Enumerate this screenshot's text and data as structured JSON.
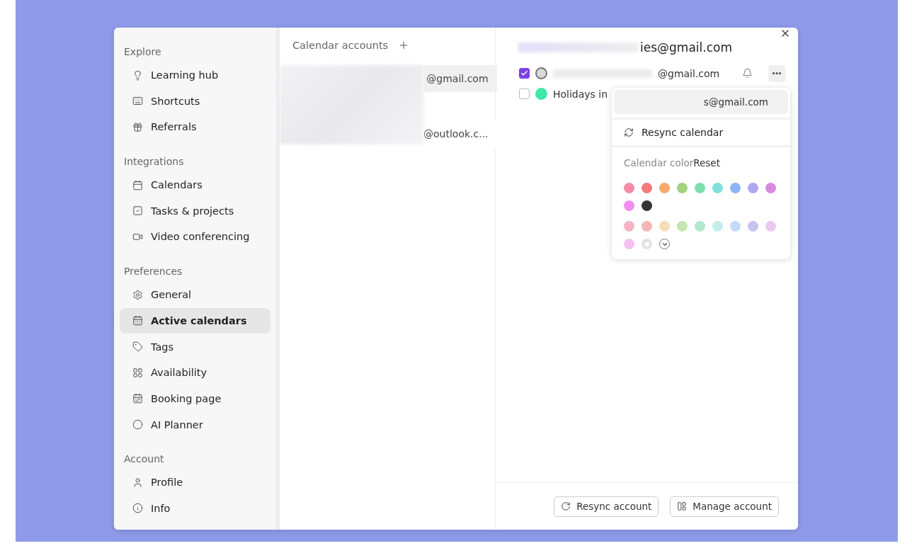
{
  "sidebar": {
    "sections": [
      {
        "title": "Explore",
        "items": [
          {
            "label": "Learning hub",
            "selected": false
          },
          {
            "label": "Shortcuts",
            "selected": false
          },
          {
            "label": "Referrals",
            "selected": false
          }
        ]
      },
      {
        "title": "Integrations",
        "items": [
          {
            "label": "Calendars",
            "selected": false
          },
          {
            "label": "Tasks & projects",
            "selected": false
          },
          {
            "label": "Video conferencing",
            "selected": false
          }
        ]
      },
      {
        "title": "Preferences",
        "items": [
          {
            "label": "General",
            "selected": false
          },
          {
            "label": "Active calendars",
            "selected": true
          },
          {
            "label": "Tags",
            "selected": false
          },
          {
            "label": "Availability",
            "selected": false
          },
          {
            "label": "Booking page",
            "selected": false
          },
          {
            "label": "AI Planner",
            "selected": false
          }
        ]
      },
      {
        "title": "Account",
        "items": [
          {
            "label": "Profile",
            "selected": false
          },
          {
            "label": "Info",
            "selected": false
          }
        ]
      }
    ]
  },
  "accounts": {
    "title": "Calendar accounts",
    "items": [
      {
        "label": "@gmail.com",
        "selected": true
      },
      {
        "label": "@outlook.c...",
        "selected": false
      }
    ]
  },
  "detail": {
    "title": "ies@gmail.com",
    "calendars": [
      {
        "label": "@gmail.com",
        "checked": true,
        "color": "#d9d9d9"
      },
      {
        "label": "Holidays in",
        "checked": false,
        "color": "#3ee8a8"
      }
    ],
    "menu": {
      "account": "s@gmail.com",
      "resync": "Resync calendar",
      "color_label": "Calendar color",
      "reset": "Reset",
      "swatches": [
        {
          "color": "#f58aa8",
          "selected": false
        },
        {
          "color": "#f57a7a",
          "selected": false
        },
        {
          "color": "#f8a96a",
          "selected": false
        },
        {
          "color": "#a3d17f",
          "selected": false
        },
        {
          "color": "#7ddfb0",
          "selected": false
        },
        {
          "color": "#7fe0de",
          "selected": false
        },
        {
          "color": "#8ab6f5",
          "selected": false
        },
        {
          "color": "#b3a6f0",
          "selected": false
        },
        {
          "color": "#d68ae0",
          "selected": false
        },
        {
          "color": "#f28ef0",
          "selected": false
        },
        {
          "color": "#333333",
          "selected": false
        }
      ],
      "light_swatches": [
        {
          "color": "#f5b3c4",
          "selected": false
        },
        {
          "color": "#f5b5b5",
          "selected": false
        },
        {
          "color": "#f7dcb8",
          "selected": false
        },
        {
          "color": "#c6e5b0",
          "selected": false
        },
        {
          "color": "#b3e8cf",
          "selected": false
        },
        {
          "color": "#c4ede9",
          "selected": false
        },
        {
          "color": "#c6daf7",
          "selected": false
        },
        {
          "color": "#c9c3f0",
          "selected": false
        },
        {
          "color": "#eec6f2",
          "selected": false
        },
        {
          "color": "#f3c0f0",
          "selected": false
        },
        {
          "color": "#e3e3e3",
          "selected": true
        }
      ]
    },
    "buttons": [
      {
        "label": "Resync account"
      },
      {
        "label": "Manage account"
      }
    ]
  }
}
